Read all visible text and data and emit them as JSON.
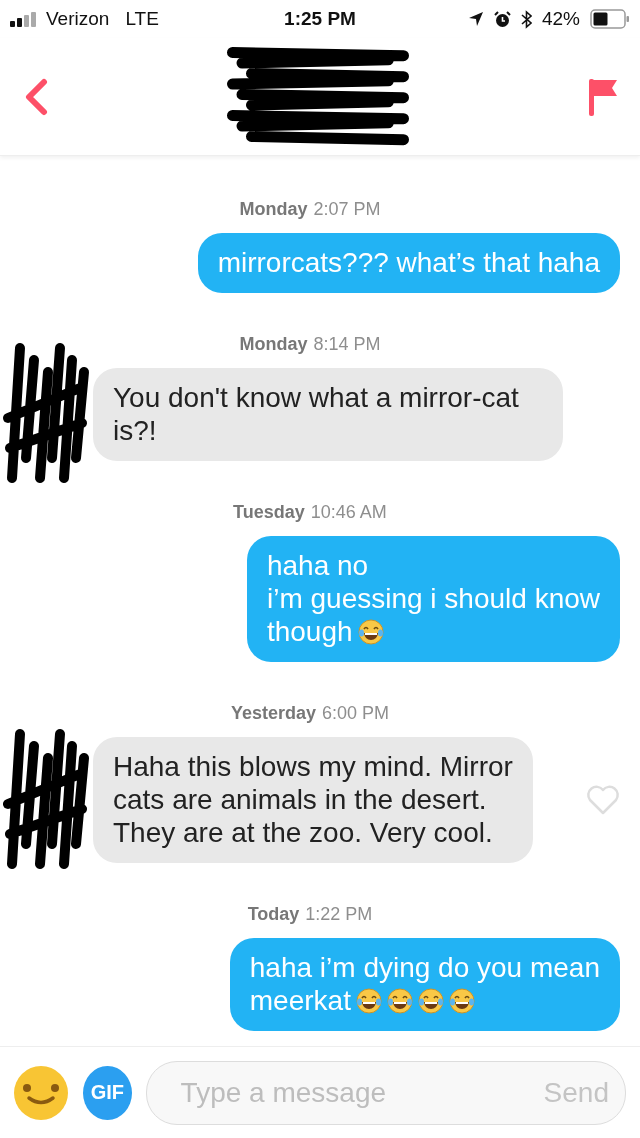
{
  "status_bar": {
    "carrier": "Verizon",
    "network": "LTE",
    "time": "1:25 PM",
    "battery": "42%"
  },
  "messages": [
    {
      "kind": "timestamp",
      "day": "Monday",
      "time": "2:07 PM"
    },
    {
      "kind": "outgoing",
      "text": "mirrorcats??? what’s that haha"
    },
    {
      "kind": "timestamp",
      "day": "Monday",
      "time": "8:14 PM"
    },
    {
      "kind": "incoming",
      "text": "You don't know what a mirror-cat is?!"
    },
    {
      "kind": "timestamp",
      "day": "Tuesday",
      "time": "10:46 AM"
    },
    {
      "kind": "outgoing",
      "text": "haha no\ni’m guessing i should know\nthough",
      "emojis": [
        {
          "kind": "tears-of-joy"
        }
      ]
    },
    {
      "kind": "timestamp",
      "day": "Yesterday",
      "time": "6:00 PM"
    },
    {
      "kind": "incoming",
      "text": "Haha this blows my mind. Mirror\ncats are animals in the desert.\nThey are at the zoo. Very cool.",
      "liked": false
    },
    {
      "kind": "timestamp",
      "day": "Today",
      "time": "1:22 PM"
    },
    {
      "kind": "outgoing",
      "text": "haha i’m dying do you mean\nmeerkat",
      "emojis": [
        {
          "kind": "tears-of-joy"
        },
        {
          "kind": "tears-of-joy"
        },
        {
          "kind": "tears-of-joy"
        },
        {
          "kind": "tears-of-joy"
        }
      ]
    }
  ],
  "composer": {
    "gif_label": "GIF",
    "placeholder": "Type a message",
    "send": {
      "label": "Send",
      "disabled": true
    }
  }
}
